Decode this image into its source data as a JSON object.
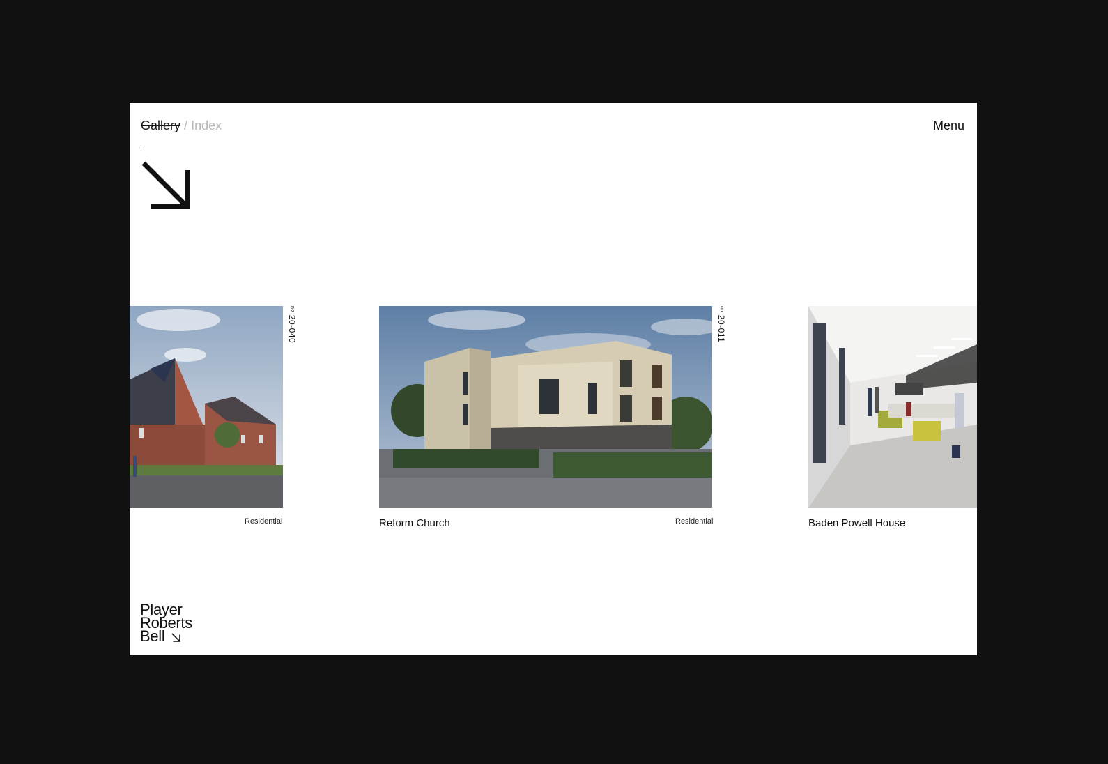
{
  "header": {
    "crumb_active": "Gallery",
    "crumb_separator": "/",
    "crumb_inactive": "Index",
    "menu_label": "Menu"
  },
  "projects": [
    {
      "title": "",
      "category": "Residential",
      "ref_prefix": "no",
      "ref": "20-040"
    },
    {
      "title": "Reform Church",
      "category": "Residential",
      "ref_prefix": "no",
      "ref": "20-011"
    },
    {
      "title": "Baden Powell House",
      "category": "",
      "ref_prefix": "",
      "ref": ""
    }
  ],
  "logo": {
    "line1": "Player",
    "line2": "Roberts",
    "line3": "Bell"
  },
  "colors": {
    "page_bg": "#111112",
    "frame_bg": "#ffffff",
    "text": "#111111",
    "muted": "#b7b7b7"
  },
  "icons": {
    "hero": "arrow-down-right-icon",
    "logo": "arrow-down-right-icon"
  }
}
